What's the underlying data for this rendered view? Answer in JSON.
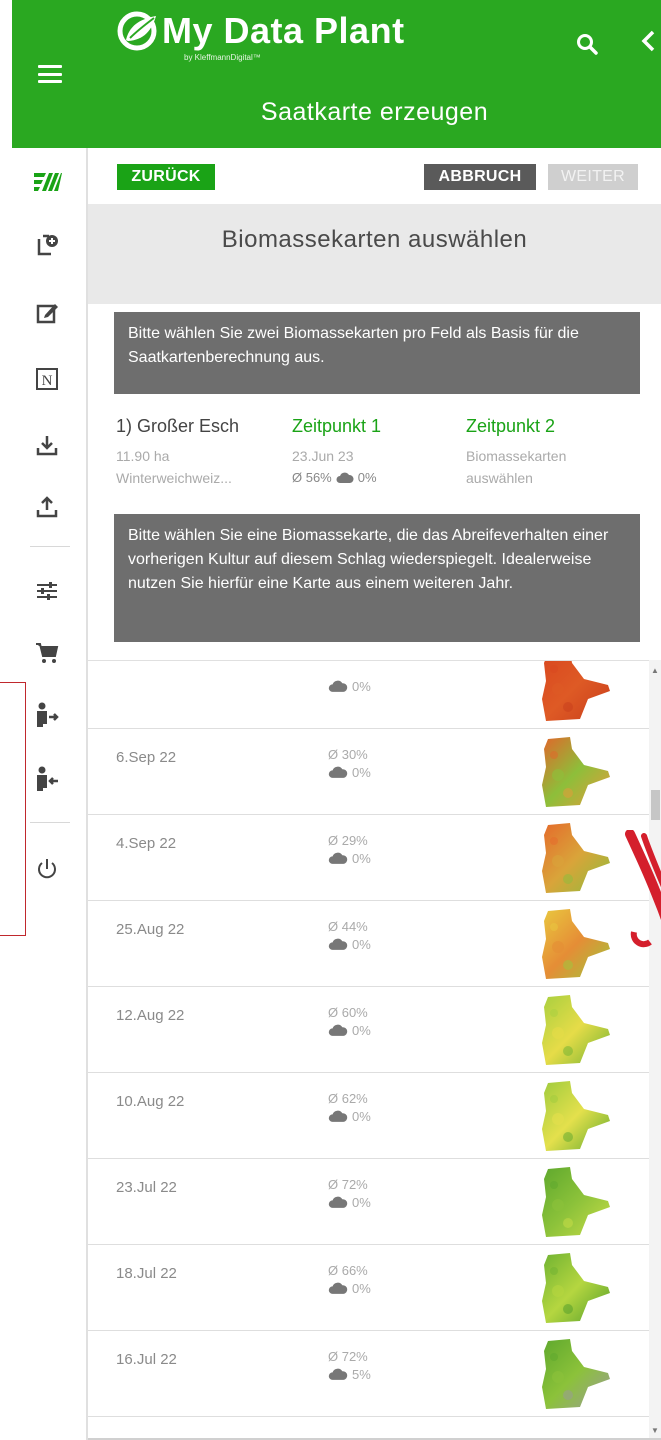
{
  "app": {
    "title": "My Data Plant",
    "subtitle": "by KleffmannDigital™",
    "page_title": "Saatkarte erzeugen"
  },
  "nav": {
    "back_label": "ZURÜCK",
    "cancel_label": "ABBRUCH",
    "next_label": "WEITER"
  },
  "sidebar": {
    "items": [
      {
        "icon": "field-stripes-icon"
      },
      {
        "icon": "add-document-icon"
      },
      {
        "icon": "edit-icon"
      },
      {
        "icon": "n-sensor-icon"
      },
      {
        "icon": "download-icon"
      },
      {
        "icon": "upload-icon"
      },
      {
        "icon": "sliders-icon"
      },
      {
        "icon": "cart-icon"
      },
      {
        "icon": "user-logout-icon"
      },
      {
        "icon": "user-login-icon"
      },
      {
        "icon": "power-icon"
      }
    ]
  },
  "section": {
    "title": "Biomassekarten auswählen",
    "info1": "Bitte wählen Sie zwei Biomassekarten pro Feld als Basis für die Saatkartenberechnung aus.",
    "info2": "Bitte wählen Sie eine Biomassekarte, die das Abreifeverhalten einer vorherigen Kultur auf diesem Schlag wiederspiegelt. Idealerweise nutzen Sie hierfür eine Karte aus einem weiteren Jahr."
  },
  "field": {
    "name": "1) Großer Esch",
    "area": "11.90 ha",
    "crop": "Winterweichweiz...",
    "t1_label": "Zeitpunkt 1",
    "t1_date": "23.Jun 23",
    "t1_mean": "Ø 56%",
    "t1_cloud": "0%",
    "t2_label": "Zeitpunkt 2",
    "t2_line1": "Biomassekarten",
    "t2_line2": "auswählen"
  },
  "maps": [
    {
      "date": "",
      "mean": "",
      "cloud": "0%",
      "colors": [
        "#d9471f",
        "#de5a25",
        "#c83d1b"
      ]
    },
    {
      "date": "6.Sep 22",
      "mean": "Ø 30%",
      "cloud": "0%",
      "colors": [
        "#e2652a",
        "#8dbf3a",
        "#e89a3a"
      ]
    },
    {
      "date": "4.Sep 22",
      "mean": "Ø 29%",
      "cloud": "0%",
      "colors": [
        "#e56a2b",
        "#d9a43a",
        "#8bbd3c"
      ]
    },
    {
      "date": "25.Aug 22",
      "mean": "Ø 44%",
      "cloud": "0%",
      "colors": [
        "#e9c83f",
        "#e58d36",
        "#9cc83d"
      ]
    },
    {
      "date": "12.Aug 22",
      "mean": "Ø 60%",
      "cloud": "0%",
      "colors": [
        "#a8cf3f",
        "#e6dc48",
        "#6fb232"
      ]
    },
    {
      "date": "10.Aug 22",
      "mean": "Ø 62%",
      "cloud": "0%",
      "colors": [
        "#9fcb3e",
        "#e4e04c",
        "#5ea82d"
      ]
    },
    {
      "date": "23.Jul 22",
      "mean": "Ø 72%",
      "cloud": "0%",
      "colors": [
        "#5ea82d",
        "#8cc23a",
        "#c9dd48"
      ]
    },
    {
      "date": "18.Jul 22",
      "mean": "Ø 66%",
      "cloud": "0%",
      "colors": [
        "#6fb232",
        "#b5d640",
        "#4f9c2a"
      ]
    },
    {
      "date": "16.Jul 22",
      "mean": "Ø 72%",
      "cloud": "5%",
      "colors": [
        "#5ea82d",
        "#8cc23a",
        "#9a9a9a"
      ]
    }
  ]
}
